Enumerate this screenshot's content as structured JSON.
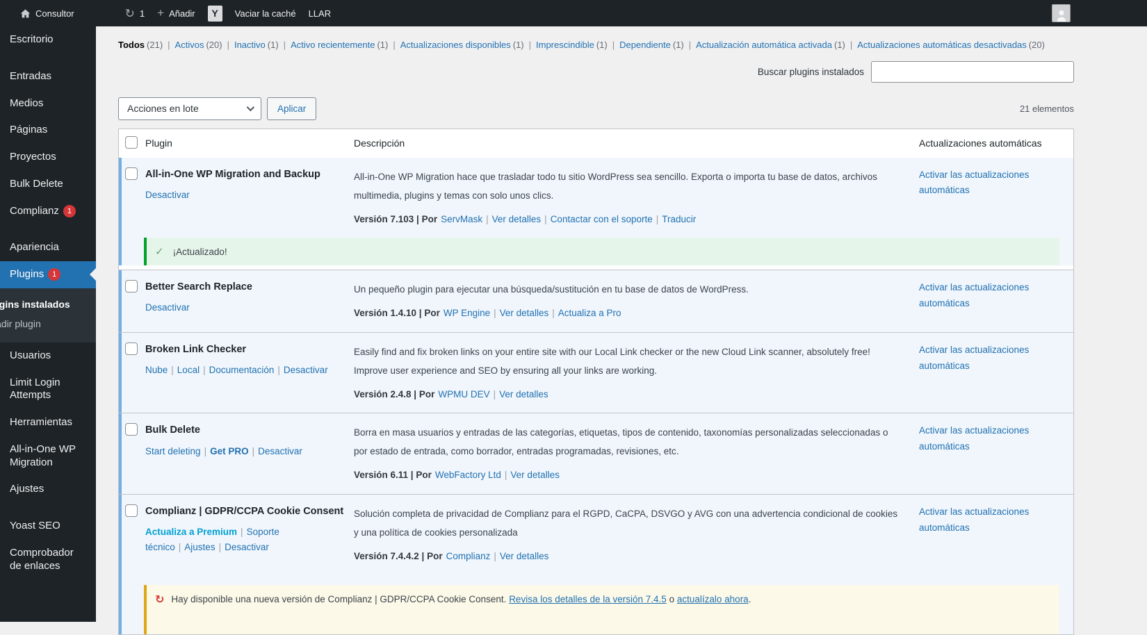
{
  "ui": {
    "sep": "|",
    "search_label": "Buscar plugins instalados",
    "bulk_select": "Acciones en lote",
    "apply_button": "Aplicar",
    "items_count": "21 elementos",
    "col_plugin": "Plugin",
    "col_description": "Descripción",
    "col_autoupdates": "Actualizaciones automáticas"
  },
  "colors": {
    "accent_blue": "#2271b1",
    "active_row_bg": "#f0f6fc",
    "active_row_stripe": "#72aee6",
    "success_green": "#00a32a",
    "warning_yellow": "#dba617",
    "alert_red": "#d63638",
    "admin_dark": "#1d2327"
  },
  "admin_bar": {
    "site_name": "Consultor",
    "updates_count": "1",
    "add_new": "Añadir",
    "yoast_glyph": "Y",
    "clear_cache": "Vaciar la caché",
    "llar": "LLAR"
  },
  "sidebar": {
    "items": [
      {
        "label": "Escritorio"
      },
      {
        "label": "Entradas"
      },
      {
        "label": "Medios"
      },
      {
        "label": "Páginas"
      },
      {
        "label": "Proyectos"
      },
      {
        "label": "Bulk Delete"
      },
      {
        "label": "Complianz",
        "badge": "1"
      },
      {
        "label": "Apariencia"
      },
      {
        "label": "Plugins",
        "badge": "1"
      },
      {
        "label": "Plugins instalados"
      },
      {
        "label": "Añadir plugin"
      },
      {
        "label": "Usuarios"
      },
      {
        "label": "Limit Login Attempts"
      },
      {
        "label": "Herramientas"
      },
      {
        "label": "All-in-One WP Migration"
      },
      {
        "label": "Ajustes"
      },
      {
        "label": "Yoast SEO"
      },
      {
        "label": "Comprobador de enlaces"
      }
    ]
  },
  "filters": [
    {
      "label": "Todos",
      "count": "(21)"
    },
    {
      "label": "Activos",
      "count": "(20)"
    },
    {
      "label": "Inactivo",
      "count": "(1)"
    },
    {
      "label": "Activo recientemente",
      "count": "(1)"
    },
    {
      "label": "Actualizaciones disponibles",
      "count": "(1)"
    },
    {
      "label": "Imprescindible",
      "count": "(1)"
    },
    {
      "label": "Dependiente",
      "count": "(1)"
    },
    {
      "label": "Actualización automática activada",
      "count": "(1)"
    },
    {
      "label": "Actualizaciones automáticas desactivadas",
      "count": "(20)"
    }
  ],
  "plugins": [
    {
      "name": "All-in-One WP Migration and Backup",
      "actions": [
        "Desactivar"
      ],
      "description": "All-in-One WP Migration hace que trasladar todo tu sitio WordPress sea sencillo. Exporta o importa tu base de datos, archivos multimedia, plugins y temas con solo unos clics.",
      "meta_prefix": "Versión 7.103 | Por",
      "meta_links": [
        "ServMask",
        "Ver detalles",
        "Contactar con el soporte",
        "Traducir"
      ],
      "autoupdate": "Activar las actualizaciones automáticas",
      "success_notice": "¡Actualizado!"
    },
    {
      "name": "Better Search Replace",
      "actions": [
        "Desactivar"
      ],
      "description": "Un pequeño plugin para ejecutar una búsqueda/sustitución en tu base de datos de WordPress.",
      "meta_prefix": "Versión 1.4.10 | Por",
      "meta_links": [
        "WP Engine",
        "Ver detalles",
        "Actualiza a Pro"
      ],
      "autoupdate": "Activar las actualizaciones automáticas"
    },
    {
      "name": "Broken Link Checker",
      "actions": [
        "Nube",
        "Local",
        "Documentación",
        "Desactivar"
      ],
      "description": "Easily find and fix broken links on your entire site with our Local Link checker or the new Cloud Link scanner, absolutely free! Improve user experience and SEO by ensuring all your links are working.",
      "meta_prefix": "Versión 2.4.8 | Por",
      "meta_links": [
        "WPMU DEV",
        "Ver detalles"
      ],
      "autoupdate": "Activar las actualizaciones automáticas"
    },
    {
      "name": "Bulk Delete",
      "actions": [
        "Start deleting",
        "Get PRO",
        "Desactivar"
      ],
      "description": "Borra en masa usuarios y entradas de las categorías, etiquetas, tipos de contenido, taxonomías personalizadas seleccionadas o por estado de entrada, como borrador, entradas programadas, revisiones, etc.",
      "meta_prefix": "Versión 6.11 | Por",
      "meta_links": [
        "WebFactory Ltd",
        "Ver detalles"
      ],
      "autoupdate": "Activar las actualizaciones automáticas"
    },
    {
      "name": "Complianz | GDPR/CCPA Cookie Consent",
      "actions": [
        "Actualiza a Premium",
        "Soporte técnico",
        "Ajustes",
        "Desactivar"
      ],
      "description": "Solución completa de privacidad de Complianz para el RGPD, CaCPA, DSVGO y AVG con una advertencia condicional de cookies y una política de cookies personalizada",
      "meta_prefix": "Versión 7.4.4.2 | Por",
      "meta_links": [
        "Complianz",
        "Ver detalles"
      ],
      "autoupdate": "Activar las actualizaciones automáticas",
      "update_notice": {
        "text_before": "Hay disponible una nueva versión de Complianz | GDPR/CCPA Cookie Consent.",
        "link_details": "Revisa los detalles de la versión 7.4.5",
        "text_middle": "o",
        "link_update": "actualízalo ahora",
        "text_after": "."
      }
    }
  ]
}
